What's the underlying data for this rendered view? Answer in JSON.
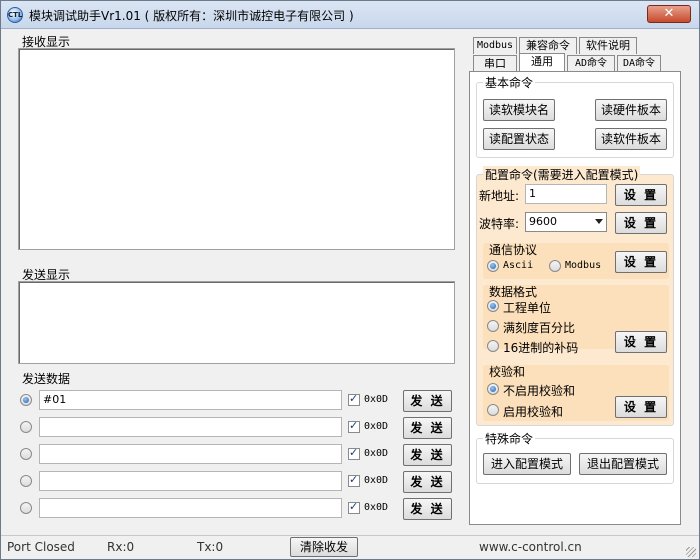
{
  "window": {
    "title": "模块调试助手Vr1.01 ( 版权所有：深圳市诚控电子有限公司 )",
    "icon": "app-logo-icon",
    "icon_text": "CTL"
  },
  "receive": {
    "label": "接收显示",
    "content": ""
  },
  "send_display": {
    "label": "发送显示",
    "content": ""
  },
  "send_data": {
    "label": "发送数据",
    "rows": [
      {
        "selected": true,
        "value": "#01",
        "suffix_checked": true,
        "suffix": "0x0D",
        "button": "发 送"
      },
      {
        "selected": false,
        "value": "",
        "suffix_checked": true,
        "suffix": "0x0D",
        "button": "发 送"
      },
      {
        "selected": false,
        "value": "",
        "suffix_checked": true,
        "suffix": "0x0D",
        "button": "发 送"
      },
      {
        "selected": false,
        "value": "",
        "suffix_checked": true,
        "suffix": "0x0D",
        "button": "发 送"
      },
      {
        "selected": false,
        "value": "",
        "suffix_checked": true,
        "suffix": "0x0D",
        "button": "发 送"
      }
    ]
  },
  "status": {
    "port": "Port Closed",
    "rx": "Rx:0",
    "tx": "Tx:0",
    "clear_button": "清除收发",
    "website": "www.c-control.cn"
  },
  "tabs": {
    "row1": [
      "Modbus",
      "兼容命令",
      "软件说明"
    ],
    "row2": [
      "串口",
      "通用",
      "AD命令",
      "DA命令"
    ],
    "active": "通用"
  },
  "basic": {
    "title": "基本命令",
    "buttons": [
      "读软模块名",
      "读硬件板本",
      "读配置状态",
      "读软件板本"
    ]
  },
  "config": {
    "title": "配置命令(需要进入配置模式)",
    "address_label": "新地址:",
    "address_value": "1",
    "baud_label": "波特率:",
    "baud_value": "9600",
    "set_label": "设 置",
    "protocol": {
      "title": "通信协议",
      "options": [
        "Ascii",
        "Modbus"
      ],
      "selected": "Ascii"
    },
    "format": {
      "title": "数据格式",
      "options": [
        "工程单位",
        "满刻度百分比",
        "16进制的补码"
      ],
      "selected": "工程单位"
    },
    "checksum": {
      "title": "校验和",
      "options": [
        "不启用校验和",
        "启用校验和"
      ],
      "selected": "不启用校验和"
    }
  },
  "special": {
    "title": "特殊命令",
    "enter": "进入配置模式",
    "exit": "退出配置模式"
  },
  "colors": {
    "group_bg": "#fde9cf",
    "inner_bg": "#fce0bb",
    "accent": "#1c5fb0"
  }
}
